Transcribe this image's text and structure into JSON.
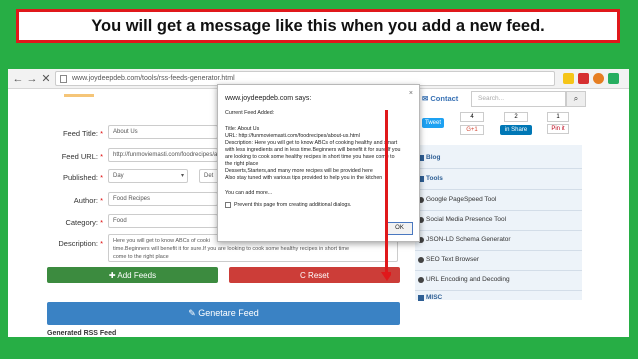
{
  "banner": {
    "text": "You will get a message like this when you add a new feed."
  },
  "browser": {
    "url": "www.joydeepdeb.com/tools/rss-feeds-generator.html",
    "back": "←",
    "forward": "→",
    "reload": "✕"
  },
  "site": {
    "contact_label": "Contact",
    "search_placeholder": "Search...",
    "search_btn": "⌕",
    "tweet_label": "Tweet",
    "gplus_count": "4",
    "gplus_label": "G+1",
    "linkedin_count": "2",
    "linkedin_label": "in Share",
    "pinit_count": "1",
    "pinit_label": "Pin it"
  },
  "form": {
    "feed_title_label": "Feed Title:",
    "feed_title_value": "About Us",
    "feed_url_label": "Feed URL:",
    "feed_url_value": "http://funmoviemasti.com/foodrecipes/ab",
    "published_label": "Published:",
    "published_day": "Day",
    "published_extra": "Det",
    "author_label": "Author:",
    "author_value": "Food Recipes",
    "category_label": "Category:",
    "category_value": "Food",
    "description_label": "Description:",
    "description_lines": [
      "Here you will get to know ABCs of cooki",
      "time.Beginners will benefit it for sure.If you are looking to cook some healthy recipes in short time",
      "come to the right place"
    ],
    "required_mark": "*",
    "add_feeds_label": "✚ Add Feeds",
    "reset_label": "C Reset",
    "generate_label": "✎ Genetare Feed",
    "generated_heading": "Generated RSS Feed"
  },
  "sidebar": {
    "blog": "Blog",
    "tools": "Tools",
    "items": [
      "Google PageSpeed Tool",
      "Social Media Presence Tool",
      "JSON-LD Schema Generator",
      "SEO Text Browser",
      "URL Encoding and Decoding"
    ],
    "misc": "MISC"
  },
  "dialog": {
    "title": "www.joydeepdeb.com says:",
    "close": "×",
    "lines": [
      "Current Feed Added:",
      "",
      "Title: About Us",
      "URL: http://funmoviemasti.com/foodrecipes/about-us.html",
      "Description: Here you will get to know ABCs of cooking healthy and smart",
      "with less ingredients and in less time.Beginners will benefit it for sure.If you",
      "are looking to cook some healthy recipes in short time you have come to",
      "the right place",
      "Desserts,Starters,and many more recipes will be provided here",
      "Also stay tuned with various tips provided to help you in the kitchen",
      "",
      "You can add more..."
    ],
    "checkbox_label": "Prevent this page from creating additional dialogs.",
    "ok_label": "OK"
  },
  "colors": {
    "background": "#27ae45",
    "banner_border": "#e0181b",
    "arrow": "#e0181b",
    "add_button": "#3c8b3f",
    "reset_button": "#cc3d38",
    "generate_button": "#3a82c4"
  }
}
